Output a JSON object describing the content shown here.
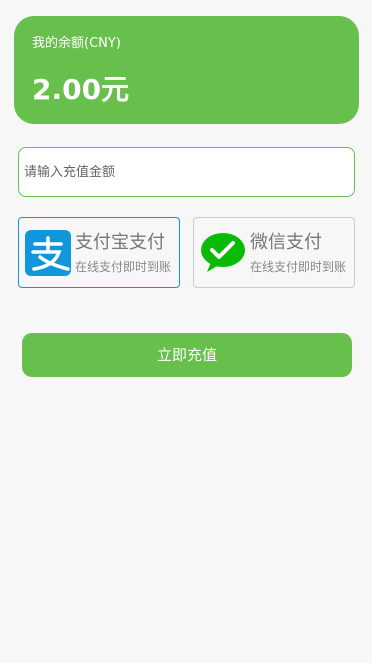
{
  "balance": {
    "label": "我的余额(CNY)",
    "amount": "2.00元"
  },
  "recharge_input": {
    "placeholder": "请输入充值金额",
    "value": ""
  },
  "payment_methods": [
    {
      "title": "支付宝支付",
      "subtitle": "在线支付即时到账",
      "icon": "alipay-icon",
      "selected": true
    },
    {
      "title": "微信支付",
      "subtitle": "在线支付即时到账",
      "icon": "wechat-icon",
      "selected": false
    }
  ],
  "submit": {
    "label": "立即充值"
  },
  "colors": {
    "accent": "#67c04c",
    "alipay_blue": "#1296db",
    "wechat_green": "#09bb07",
    "background": "#f7f7f7"
  }
}
